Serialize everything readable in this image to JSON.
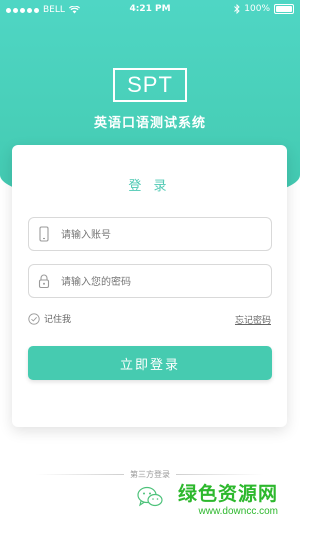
{
  "status_bar": {
    "carrier": "BELL",
    "time": "4:21 PM",
    "battery": "100%"
  },
  "app": {
    "logo": "SPT",
    "title": "英语口语测试系统"
  },
  "login_card": {
    "title": "登 录",
    "account_placeholder": "请输入账号",
    "password_placeholder": "请输入您的密码",
    "remember_label": "记住我",
    "forgot_label": "忘记密码",
    "login_button": "立即登录"
  },
  "third_party": {
    "label": "第三方登录",
    "providers": [
      "wechat-icon"
    ]
  },
  "watermark": {
    "title": "绿色资源网",
    "url": "www.downcc.com"
  },
  "colors": {
    "brand": "#48cfb8",
    "button": "#46cbb0",
    "watermark": "#2db82d"
  }
}
